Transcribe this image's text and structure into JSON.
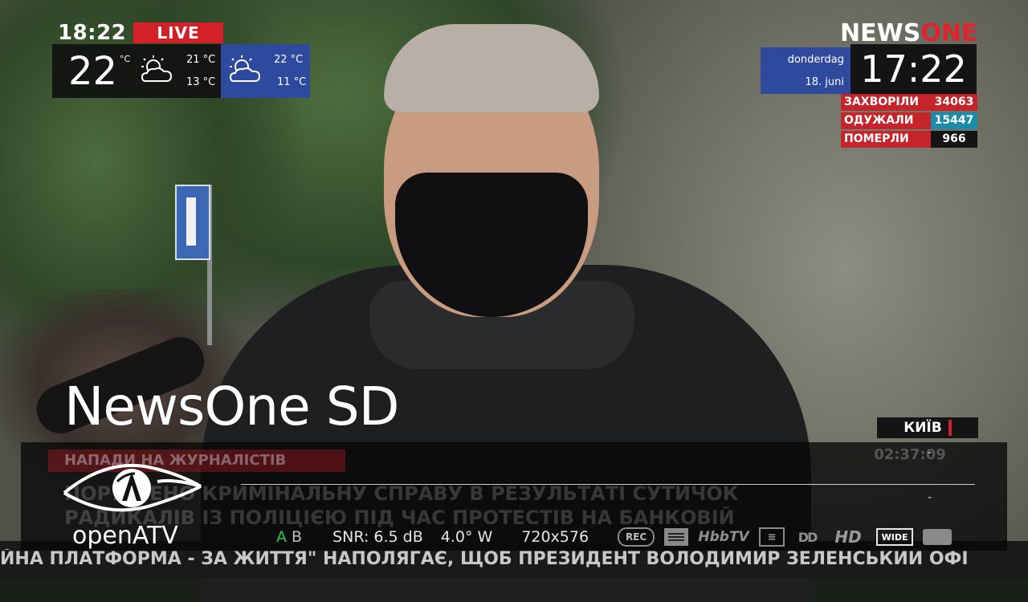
{
  "broadcast": {
    "time_top": "18:22",
    "live_label": "LIVE",
    "weather_today": {
      "temp": "22",
      "unit": "°C",
      "icon": "partly-cloudy-icon",
      "high": "21 °C",
      "low": "13 °C"
    },
    "weather_next": {
      "icon": "partly-cloudy-icon",
      "high": "22 °C",
      "low": "11 °C"
    },
    "brand_news": "NEWS",
    "brand_one": "ONE",
    "date_day": "donderdag",
    "date_num": "18. juni",
    "clock": "17:22",
    "stats": [
      {
        "label": "ЗАХВОРІЛИ",
        "value": "34063",
        "color": "#c4242a"
      },
      {
        "label": "ОДУЖАЛИ",
        "value": "15447",
        "color": "#1b8ba8"
      },
      {
        "label": "ПОМЕРЛИ",
        "value": "966",
        "color": "#141414"
      }
    ],
    "city": "КИЇВ",
    "banner_label": "НАПАДИ НА ЖУРНАЛІСТІВ",
    "headline_line1": "ПОРУШЕНО КРИМІНАЛЬНУ СПРАВУ В РЕЗУЛЬТАТІ СУТИЧОК",
    "headline_line2": "РАДИКАЛІВ ІЗ ПОЛІЦІЄЮ ПІД ЧАС ПРОТЕСТІВ НА БАНКОВІЙ",
    "pip_time": "02:37:09",
    "ticker": "ЙНА ПЛАТФОРМА - ЗА ЖИТТЯ\" НАПОЛЯГАЄ, ЩОБ ПРЕЗИДЕНТ ВОЛОДИМИР ЗЕЛЕНСЬКИЙ ОФІ"
  },
  "infobar": {
    "channel_name": "NewsOne SD",
    "logo_text": "openATV",
    "now_dash": "-",
    "next_dash": "-",
    "audio_a": "A",
    "audio_b": "B",
    "snr": "SNR: 6.5 dB",
    "orbital_position": "4.0° W",
    "resolution": "720x576",
    "icons": {
      "rec": "REC",
      "hbbtv": "HbbTV",
      "dolby": "DD",
      "hd": "HD",
      "wide": "WIDE"
    },
    "accent_green": "#30c94a"
  }
}
